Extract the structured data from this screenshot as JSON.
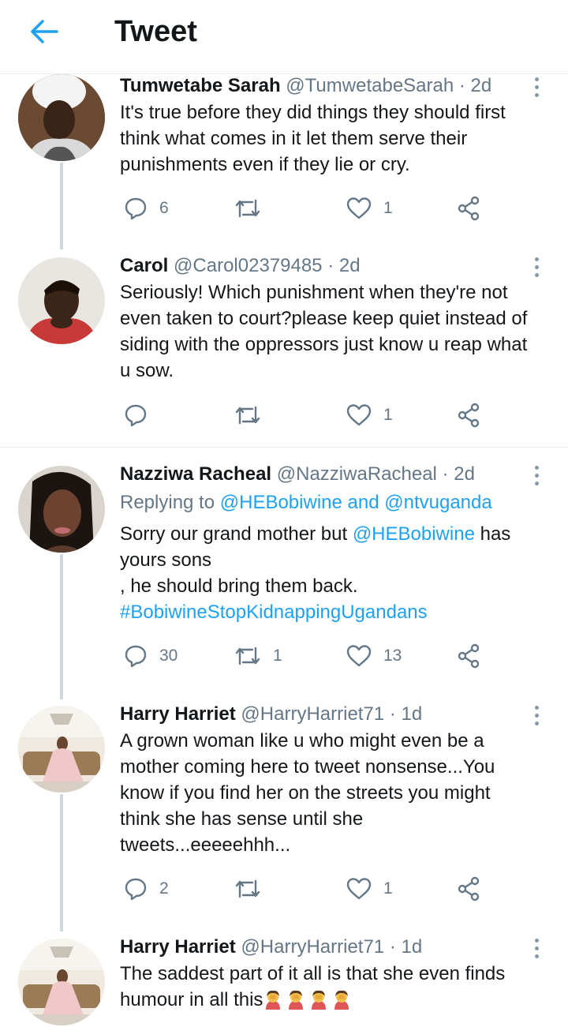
{
  "header": {
    "title": "Tweet"
  },
  "tweets": [
    {
      "name": "Tumwetabe Sarah",
      "handle": "@TumwetabeSarah",
      "dot": "·",
      "time": "2d",
      "lines": [
        "It's true before they did things they should first",
        "think what comes in it let them serve their",
        "punishments even if they lie or cry."
      ],
      "reply_count": "6",
      "retweet_count": "",
      "like_count": "1"
    },
    {
      "name": "Carol",
      "handle": "@Carol02379485",
      "dot": "·",
      "time": "2d",
      "lines": [
        "Seriously! Which punishment when they're not",
        "even taken to court?please  keep quiet instead of",
        "siding with the oppressors just know u reap what",
        "u sow."
      ],
      "reply_count": "",
      "retweet_count": "",
      "like_count": "1"
    },
    {
      "name": "Nazziwa Racheal",
      "handle": "@NazziwaRacheal",
      "dot": "·",
      "time": "2d",
      "replying_prefix": "Replying to ",
      "replying_to_1": "@HEBobiwine",
      "replying_and": " and ",
      "replying_to_2": "@ntvuganda",
      "line1_a": "Sorry our grand mother but ",
      "line1_mention": "@HEBobiwine",
      "line1_b": " has",
      "line2": "yours sons",
      "line3": ", he should bring them back.",
      "hashtag": "#BobiwineStopKidnappingUgandans",
      "reply_count": "30",
      "retweet_count": "1",
      "like_count": "13"
    },
    {
      "name": "Harry Harriet",
      "handle": "@HarryHarriet71",
      "dot": "·",
      "time": "1d",
      "lines": [
        "A grown woman like u who might even be a",
        "mother coming here to tweet nonsense...You",
        "know if you find her on the streets you might",
        "think she has sense until she",
        "tweets...eeeeehhh..."
      ],
      "reply_count": "2",
      "retweet_count": "",
      "like_count": "1"
    },
    {
      "name": "Harry Harriet",
      "handle": "@HarryHarriet71",
      "dot": "·",
      "time": "1d",
      "lines": [
        "The saddest part of it all is that she even finds",
        "humour in all this"
      ],
      "emoji": "woman-facepalming-emoji"
    }
  ],
  "colors": {
    "link": "#1da1f2",
    "muted": "#657786",
    "thread_line": "#cfd9de",
    "icon": "#657786"
  }
}
